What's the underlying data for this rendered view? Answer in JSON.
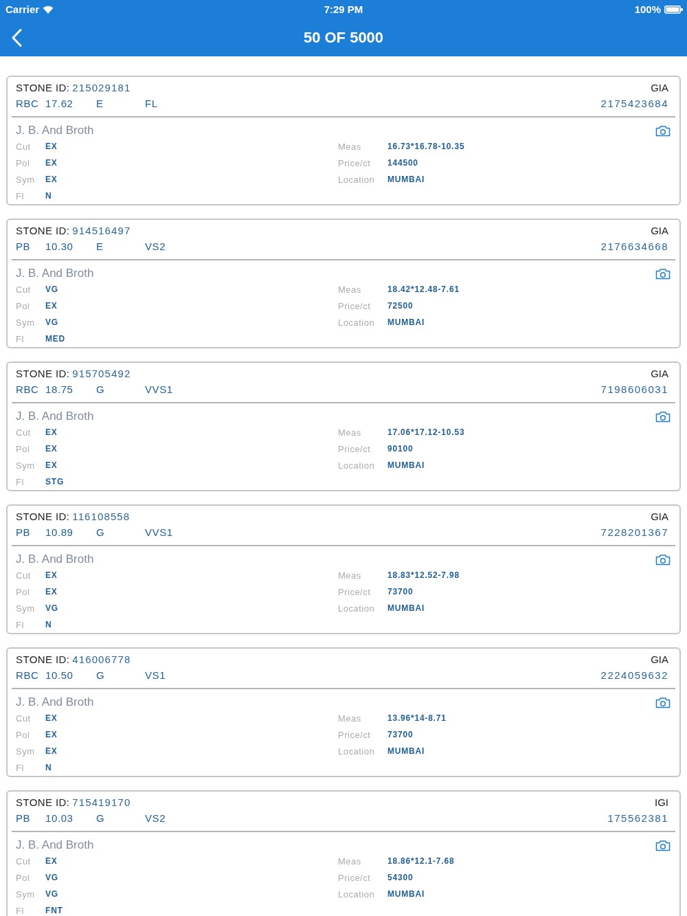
{
  "status_bar": {
    "carrier": "Carrier",
    "time": "7:29 PM",
    "battery": "100%"
  },
  "nav_bar": {
    "title": "50 OF 5000"
  },
  "stones": [
    {
      "id_label": "STONE ID:",
      "stone_id": "215029181",
      "lab": "GIA",
      "specs": [
        "RBC",
        "17.62",
        "E",
        "FL"
      ],
      "report_number": "2175423684",
      "seller": "J. B. And Broth",
      "details_left": [
        {
          "label": "Cut",
          "value": "EX"
        },
        {
          "label": "Pol",
          "value": "EX"
        },
        {
          "label": "Sym",
          "value": "EX"
        },
        {
          "label": "Fl",
          "value": "N"
        }
      ],
      "details_right": [
        {
          "label": "Meas",
          "value": "16.73*16.78-10.35"
        },
        {
          "label": "Price/ct",
          "value": "144500"
        },
        {
          "label": "Location",
          "value": "MUMBAI"
        }
      ]
    },
    {
      "id_label": "STONE ID:",
      "stone_id": "914516497",
      "lab": "GIA",
      "specs": [
        "PB",
        "10.30",
        "E",
        "VS2"
      ],
      "report_number": "2176634668",
      "seller": "J. B. And Broth",
      "details_left": [
        {
          "label": "Cut",
          "value": "VG"
        },
        {
          "label": "Pol",
          "value": "EX"
        },
        {
          "label": "Sym",
          "value": "VG"
        },
        {
          "label": "Fl",
          "value": "MED"
        }
      ],
      "details_right": [
        {
          "label": "Meas",
          "value": "18.42*12.48-7.61"
        },
        {
          "label": "Price/ct",
          "value": "72500"
        },
        {
          "label": "Location",
          "value": "MUMBAI"
        }
      ]
    },
    {
      "id_label": "STONE ID:",
      "stone_id": "915705492",
      "lab": "GIA",
      "specs": [
        "RBC",
        "18.75",
        "G",
        "VVS1"
      ],
      "report_number": "7198606031",
      "seller": "J. B. And Broth",
      "details_left": [
        {
          "label": "Cut",
          "value": "EX"
        },
        {
          "label": "Pol",
          "value": "EX"
        },
        {
          "label": "Sym",
          "value": "EX"
        },
        {
          "label": "Fl",
          "value": "STG"
        }
      ],
      "details_right": [
        {
          "label": "Meas",
          "value": "17.06*17.12-10.53"
        },
        {
          "label": "Price/ct",
          "value": "90100"
        },
        {
          "label": "Location",
          "value": "MUMBAI"
        }
      ]
    },
    {
      "id_label": "STONE ID:",
      "stone_id": "116108558",
      "lab": "GIA",
      "specs": [
        "PB",
        "10.89",
        "G",
        "VVS1"
      ],
      "report_number": "7228201367",
      "seller": "J. B. And Broth",
      "details_left": [
        {
          "label": "Cut",
          "value": "EX"
        },
        {
          "label": "Pol",
          "value": "EX"
        },
        {
          "label": "Sym",
          "value": "VG"
        },
        {
          "label": "Fl",
          "value": "N"
        }
      ],
      "details_right": [
        {
          "label": "Meas",
          "value": "18.83*12.52-7.98"
        },
        {
          "label": "Price/ct",
          "value": "73700"
        },
        {
          "label": "Location",
          "value": "MUMBAI"
        }
      ]
    },
    {
      "id_label": "STONE ID:",
      "stone_id": "416006778",
      "lab": "GIA",
      "specs": [
        "RBC",
        "10.50",
        "G",
        "VS1"
      ],
      "report_number": "2224059632",
      "seller": "J. B. And Broth",
      "details_left": [
        {
          "label": "Cut",
          "value": "EX"
        },
        {
          "label": "Pol",
          "value": "EX"
        },
        {
          "label": "Sym",
          "value": "EX"
        },
        {
          "label": "Fl",
          "value": "N"
        }
      ],
      "details_right": [
        {
          "label": "Meas",
          "value": "13.96*14-8.71"
        },
        {
          "label": "Price/ct",
          "value": "73700"
        },
        {
          "label": "Location",
          "value": "MUMBAI"
        }
      ]
    },
    {
      "id_label": "STONE ID:",
      "stone_id": "715419170",
      "lab": "IGI",
      "specs": [
        "PB",
        "10.03",
        "G",
        "VS2"
      ],
      "report_number": "175562381",
      "seller": "J. B. And Broth",
      "details_left": [
        {
          "label": "Cut",
          "value": "EX"
        },
        {
          "label": "Pol",
          "value": "VG"
        },
        {
          "label": "Sym",
          "value": "VG"
        },
        {
          "label": "Fl",
          "value": "FNT"
        }
      ],
      "details_right": [
        {
          "label": "Meas",
          "value": "18.86*12.1-7.68"
        },
        {
          "label": "Price/ct",
          "value": "54300"
        },
        {
          "label": "Location",
          "value": "MUMBAI"
        }
      ]
    }
  ]
}
